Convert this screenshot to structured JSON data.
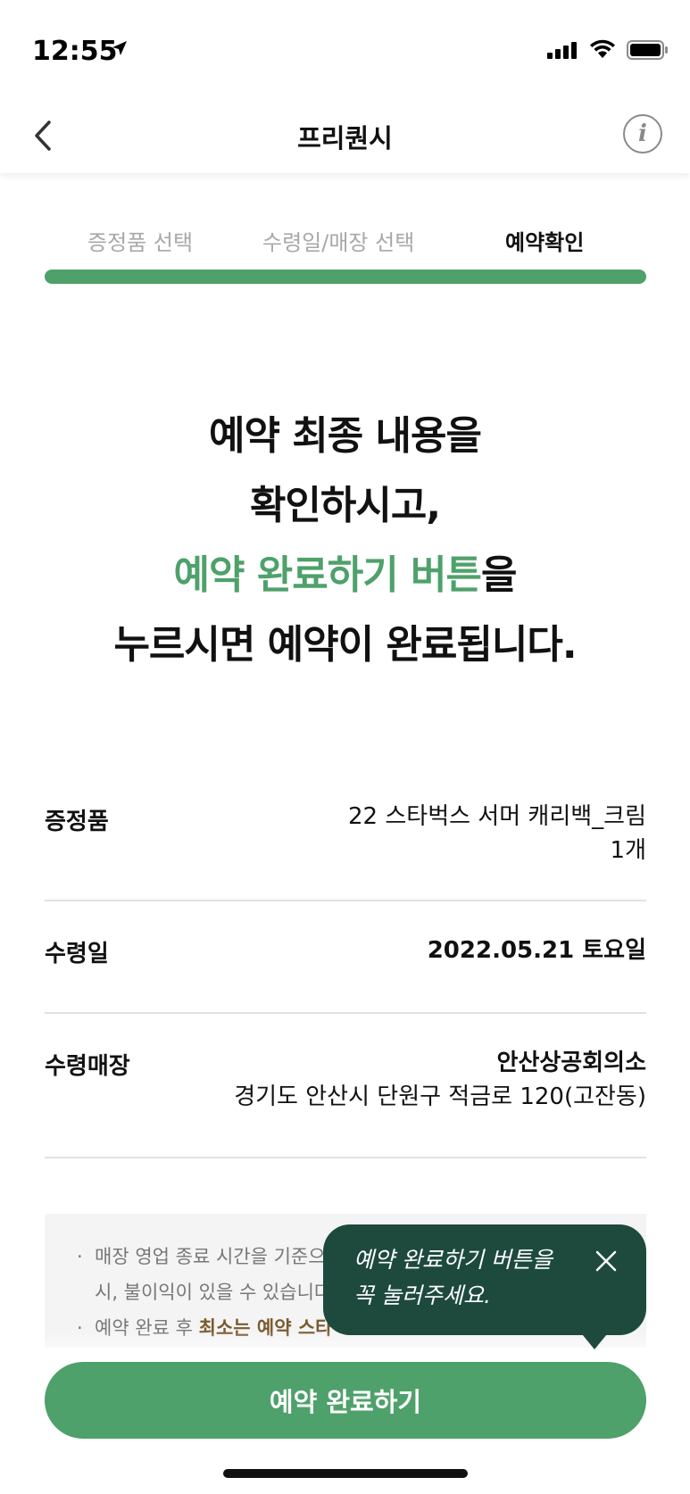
{
  "status_bar": {
    "time": "12:55",
    "icons": [
      "location-arrow-icon",
      "signal-icon",
      "wifi-icon",
      "battery-icon"
    ]
  },
  "header": {
    "title": "프리퀀시",
    "back_icon": "chevron-left-icon",
    "info_icon": "info-icon",
    "info_glyph": "i"
  },
  "steps": {
    "items": [
      "증정품 선택",
      "수령일/매장 선택",
      "예약확인"
    ],
    "active_index": 2,
    "progress": 1.0
  },
  "message": {
    "line1": "예약 최종 내용을",
    "line2": "확인하시고,",
    "line3_accent": "예약 완료하기 버튼",
    "line3_rest": "을",
    "line4": "누르시면 예약이 완료됩니다."
  },
  "details": {
    "gift_label": "증정품",
    "gift_name": "22 스타벅스 서머 캐리백_크림",
    "gift_qty": "1개",
    "date_label": "수령일",
    "date_value": "2022.05.21 토요일",
    "store_label": "수령매장",
    "store_name": "안산상공회의소",
    "store_address": "경기도 안산시 단원구 적금로 120(고잔동)"
  },
  "notice": {
    "bullet": "·",
    "item1_line1": "매장 영업 종료 시간을 기준으로",
    "item1_line2": "시, 불이익이 있을 수 있습니다",
    "item2_prefix": "예약 완료 후",
    "item2_emphasis": "최소는 예약 스타"
  },
  "tooltip": {
    "line1": "예약 완료하기 버튼을",
    "line2": "꼭 눌러주세요.",
    "close_icon": "close-icon"
  },
  "cta": {
    "label": "예약 완료하기"
  },
  "colors": {
    "accent_green": "#4ea16a",
    "tooltip_bg": "#1e4a3e",
    "emphasis_brown": "#7a5a2e"
  }
}
